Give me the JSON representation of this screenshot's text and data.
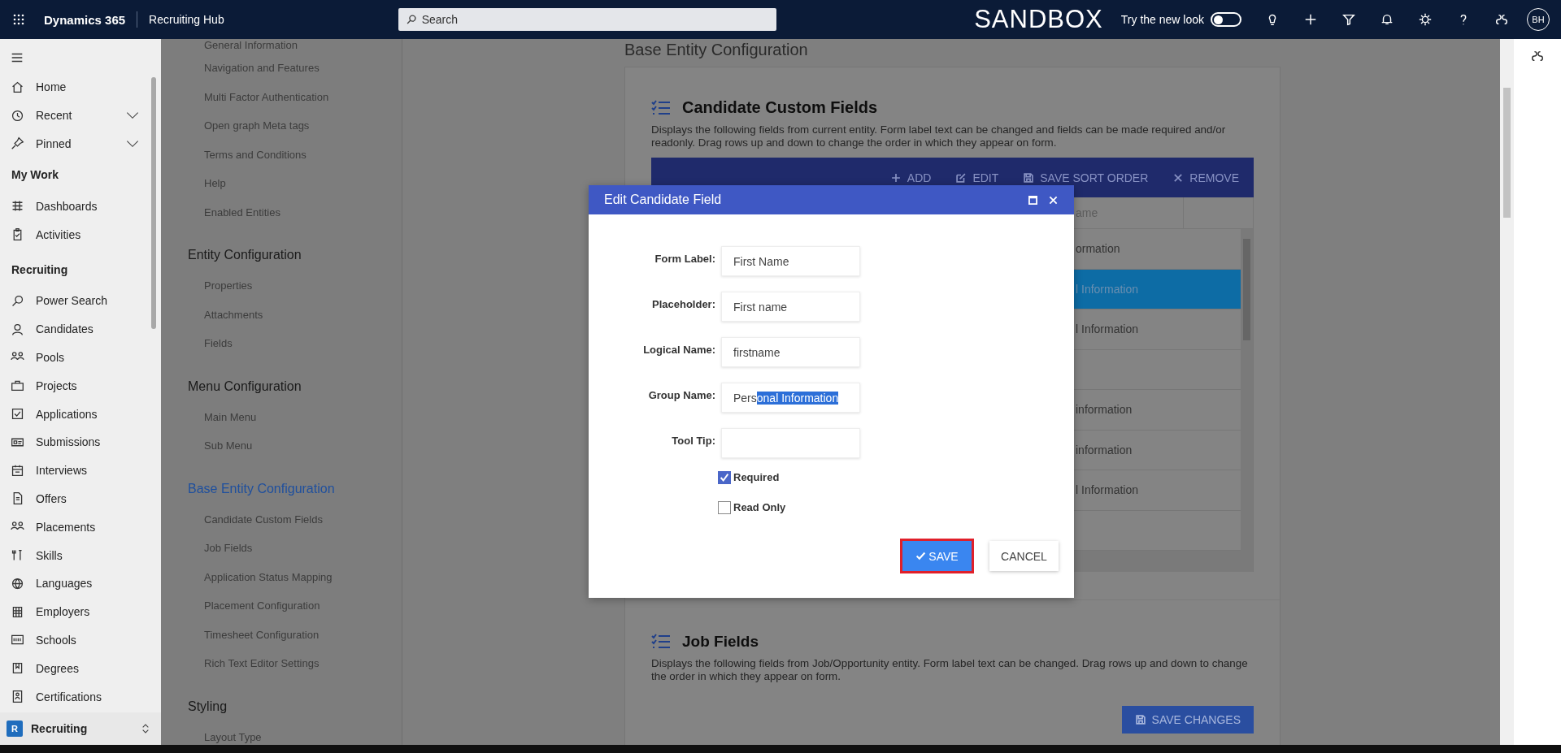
{
  "top_bar": {
    "app_name": "Dynamics 365",
    "area": "Recruiting Hub",
    "search": {
      "placeholder": "Search"
    },
    "environment": "SANDBOX",
    "new_look": {
      "label": "Try the new look",
      "on": false
    },
    "avatar": "BH"
  },
  "sidebar": {
    "groups": [
      {
        "items": [
          {
            "label": "Home",
            "kind": "link"
          },
          {
            "label": "Recent",
            "kind": "expandable",
            "expanded": false
          },
          {
            "label": "Pinned",
            "kind": "expandable",
            "expanded": false
          }
        ]
      },
      {
        "title": "My Work",
        "items": [
          {
            "label": "Dashboards",
            "kind": "link"
          },
          {
            "label": "Activities",
            "kind": "link"
          }
        ]
      },
      {
        "title": "Recruiting",
        "items": [
          {
            "label": "Power Search",
            "kind": "link"
          },
          {
            "label": "Candidates",
            "kind": "link"
          },
          {
            "label": "Pools",
            "kind": "link"
          },
          {
            "label": "Projects",
            "kind": "link"
          },
          {
            "label": "Applications",
            "kind": "link"
          },
          {
            "label": "Submissions",
            "kind": "link"
          },
          {
            "label": "Interviews",
            "kind": "link"
          },
          {
            "label": "Offers",
            "kind": "link"
          },
          {
            "label": "Placements",
            "kind": "link"
          },
          {
            "label": "Skills",
            "kind": "link"
          },
          {
            "label": "Languages",
            "kind": "link"
          },
          {
            "label": "Employers",
            "kind": "link"
          },
          {
            "label": "Schools",
            "kind": "link"
          },
          {
            "label": "Degrees",
            "kind": "link"
          },
          {
            "label": "Certifications",
            "kind": "link"
          }
        ]
      }
    ],
    "area_switcher": {
      "initial": "R",
      "label": "Recruiting"
    }
  },
  "settings_nav": {
    "sections": [
      {
        "items": [
          "General Information",
          "Navigation and Features",
          "Multi Factor Authentication",
          "Open graph Meta tags",
          "Terms and Conditions",
          "Help",
          "Enabled Entities"
        ]
      },
      {
        "title": "Entity Configuration",
        "selected": false,
        "items": [
          "Properties",
          "Attachments",
          "Fields"
        ]
      },
      {
        "title": "Menu Configuration",
        "selected": false,
        "items": [
          "Main Menu",
          "Sub Menu"
        ]
      },
      {
        "title": "Base Entity Configuration",
        "selected": true,
        "items": [
          "Candidate Custom Fields",
          "Job Fields",
          "Application Status Mapping",
          "Placement Configuration",
          "Timesheet Configuration",
          "Rich Text Editor Settings"
        ]
      },
      {
        "title": "Styling",
        "selected": false,
        "items": [
          "Layout Type"
        ]
      }
    ]
  },
  "page_title": "Base Entity Configuration",
  "candidate_fields": {
    "title": "Candidate Custom Fields",
    "description": "Displays the following fields from current entity. Form label text can be changed and fields can be made required and/or readonly. Drag rows up and down to change the order in which they appear on form.",
    "toolbar": [
      {
        "label": "ADD",
        "kind": "add"
      },
      {
        "label": "EDIT",
        "kind": "edit"
      },
      {
        "label": "SAVE SORT ORDER",
        "kind": "save"
      },
      {
        "label": "REMOVE",
        "kind": "remove"
      }
    ],
    "table": {
      "columns": [
        "ame"
      ],
      "rows": [
        {
          "cells": [
            "ormation"
          ],
          "selected": false
        },
        {
          "cells": [
            "l Information"
          ],
          "selected": true
        },
        {
          "cells": [
            "l Information"
          ],
          "selected": false
        },
        {
          "cells": [],
          "selected": false
        },
        {
          "cells": [
            "information"
          ],
          "selected": false
        },
        {
          "cells": [
            "information"
          ],
          "selected": false
        },
        {
          "cells": [
            "l Information"
          ],
          "selected": false
        },
        {
          "cells": [],
          "selected": false
        }
      ]
    }
  },
  "job_fields": {
    "title": "Job Fields",
    "description": "Displays the following fields from Job/Opportunity entity. Form label text can be changed. Drag rows up and down to change the order in which they appear on form.",
    "button": "SAVE CHANGES"
  },
  "dialog": {
    "title": "Edit Candidate Field",
    "fields": [
      {
        "label": "Form Label:",
        "value": "First Name"
      },
      {
        "label": "Placeholder:",
        "value": "First name"
      },
      {
        "label": "Logical Name:",
        "value": "firstname"
      },
      {
        "label": "Group Name:",
        "value": "Pers",
        "selected_text": "onal Information"
      },
      {
        "label": "Tool Tip:"
      }
    ],
    "checkboxes": [
      {
        "label": "Required",
        "checked": true
      },
      {
        "label": "Read Only",
        "checked": false
      }
    ],
    "buttons": [
      {
        "label": "SAVE",
        "kind": "primary",
        "highlighted": true
      },
      {
        "label": "CANCEL",
        "kind": "secondary",
        "highlighted": false
      }
    ]
  }
}
